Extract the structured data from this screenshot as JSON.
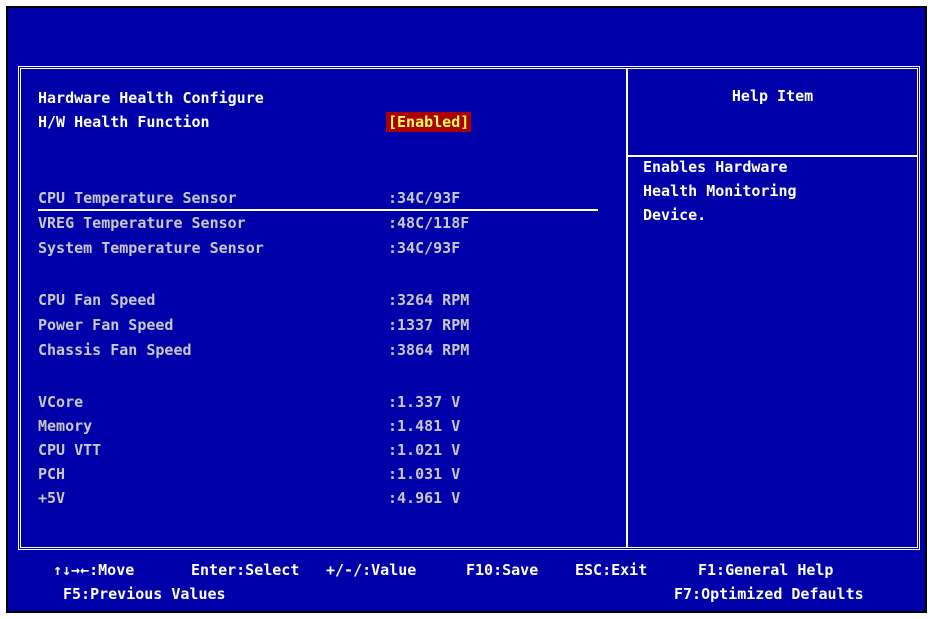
{
  "page": {
    "section_title": "Hardware Health Configure",
    "hw_function": {
      "label": "H/W Health Function",
      "value": "[Enabled]"
    },
    "temperatures": [
      {
        "label": "CPU Temperature Sensor",
        "value": ":34C/93F"
      },
      {
        "label": "VREG Temperature Sensor",
        "value": ":48C/118F"
      },
      {
        "label": "System Temperature Sensor",
        "value": ":34C/93F"
      }
    ],
    "fans": [
      {
        "label": "CPU Fan Speed",
        "value": ":3264 RPM"
      },
      {
        "label": "Power Fan Speed",
        "value": ":1337 RPM"
      },
      {
        "label": "Chassis Fan Speed",
        "value": ":3864 RPM"
      }
    ],
    "voltages": [
      {
        "label": "VCore",
        "value": ":1.337 V"
      },
      {
        "label": "Memory",
        "value": ":1.481 V"
      },
      {
        "label": "CPU VTT",
        "value": ":1.021 V"
      },
      {
        "label": "PCH",
        "value": ":1.031 V"
      },
      {
        "label": "+5V",
        "value": ":4.961 V"
      }
    ]
  },
  "help": {
    "title": "Help Item",
    "lines": [
      "Enables Hardware",
      "Health Monitoring",
      "Device."
    ]
  },
  "footer": {
    "move": "↑↓→←:Move",
    "select": "Enter:Select",
    "value": "+/-/:Value",
    "save": "F10:Save",
    "exit": "ESC:Exit",
    "help": "F1:General Help",
    "previous": "F5:Previous Values",
    "defaults": "F7:Optimized Defaults"
  },
  "colors": {
    "background": "#0000aa",
    "text": "#ffffff",
    "dim_text": "#c8c8c8",
    "highlight_bg": "#aa0000",
    "highlight_text": "#ffff55"
  }
}
